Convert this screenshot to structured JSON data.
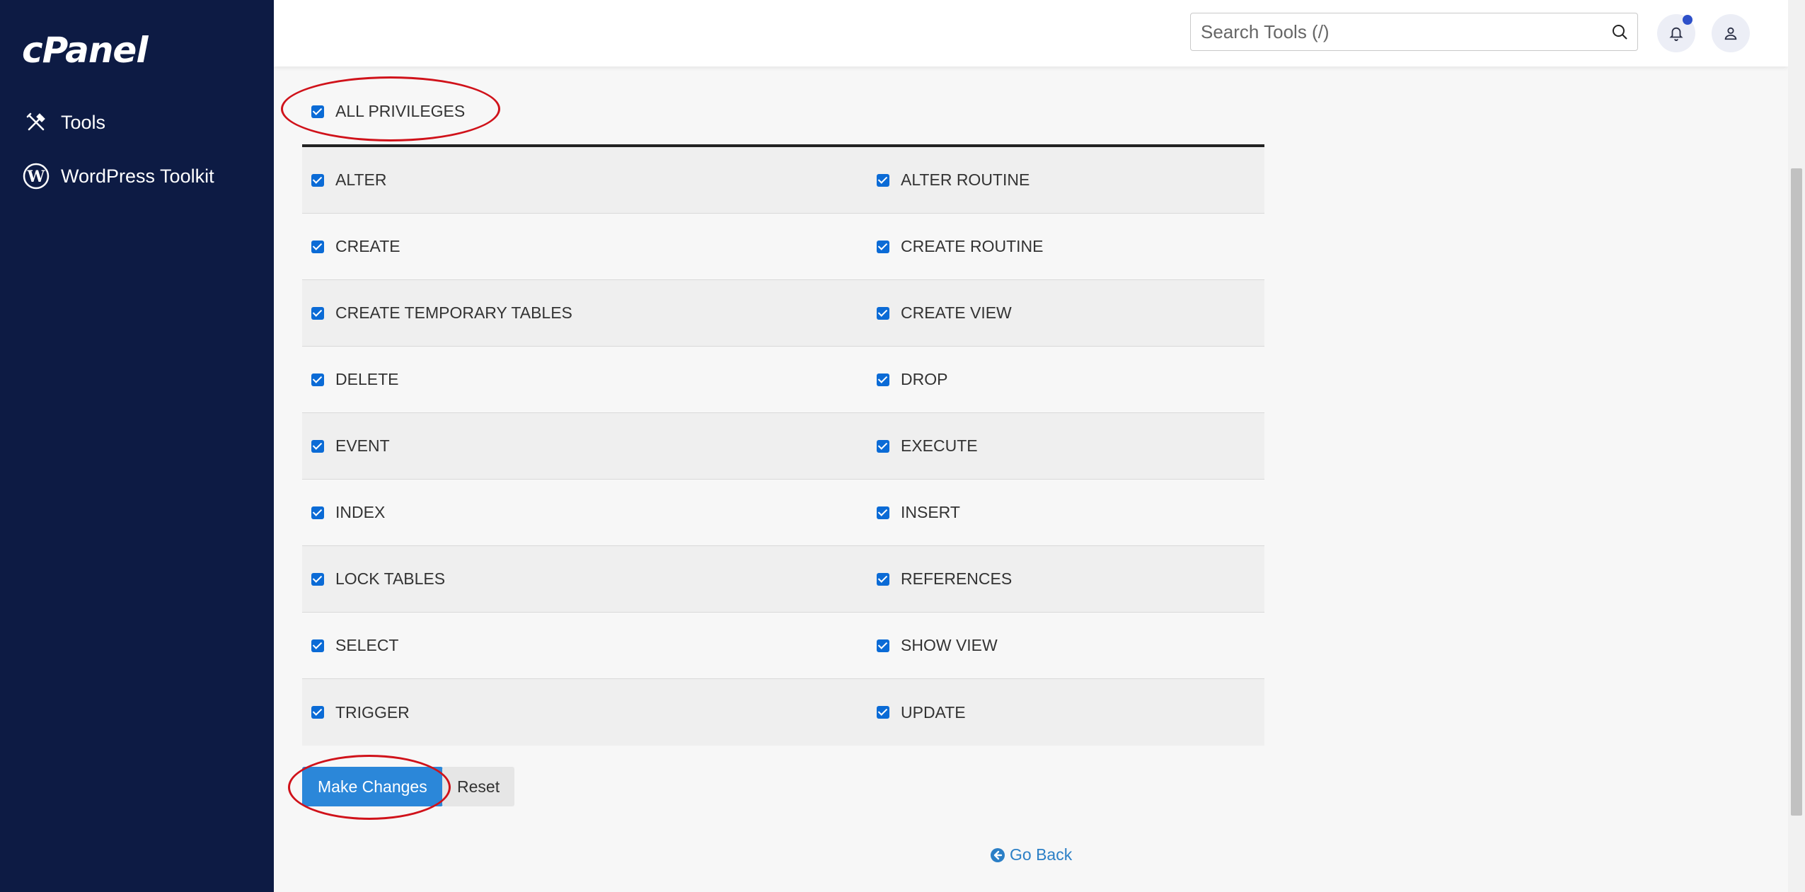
{
  "sidebar": {
    "logo_text": "cPanel",
    "items": [
      {
        "label": "Tools",
        "icon": "tools-icon"
      },
      {
        "label": "WordPress Toolkit",
        "icon": "wordpress-icon"
      }
    ]
  },
  "header": {
    "search": {
      "placeholder": "Search Tools (/)",
      "value": ""
    },
    "notification_badge_color": "#2d50c9"
  },
  "privileges": {
    "all": {
      "label": "ALL PRIVILEGES",
      "checked": true
    },
    "rows": [
      [
        {
          "label": "ALTER",
          "checked": true
        },
        {
          "label": "ALTER ROUTINE",
          "checked": true
        }
      ],
      [
        {
          "label": "CREATE",
          "checked": true
        },
        {
          "label": "CREATE ROUTINE",
          "checked": true
        }
      ],
      [
        {
          "label": "CREATE TEMPORARY TABLES",
          "checked": true
        },
        {
          "label": "CREATE VIEW",
          "checked": true
        }
      ],
      [
        {
          "label": "DELETE",
          "checked": true
        },
        {
          "label": "DROP",
          "checked": true
        }
      ],
      [
        {
          "label": "EVENT",
          "checked": true
        },
        {
          "label": "EXECUTE",
          "checked": true
        }
      ],
      [
        {
          "label": "INDEX",
          "checked": true
        },
        {
          "label": "INSERT",
          "checked": true
        }
      ],
      [
        {
          "label": "LOCK TABLES",
          "checked": true
        },
        {
          "label": "REFERENCES",
          "checked": true
        }
      ],
      [
        {
          "label": "SELECT",
          "checked": true
        },
        {
          "label": "SHOW VIEW",
          "checked": true
        }
      ],
      [
        {
          "label": "TRIGGER",
          "checked": true
        },
        {
          "label": "UPDATE",
          "checked": true
        }
      ]
    ]
  },
  "actions": {
    "make_changes_label": "Make Changes",
    "reset_label": "Reset",
    "go_back_label": "Go Back"
  },
  "colors": {
    "sidebar_bg": "#0d1b44",
    "primary_button": "#2b87d9",
    "checkbox": "#0b6bd6",
    "highlight_ellipse": "#d0121a",
    "link": "#2b7fc6"
  }
}
